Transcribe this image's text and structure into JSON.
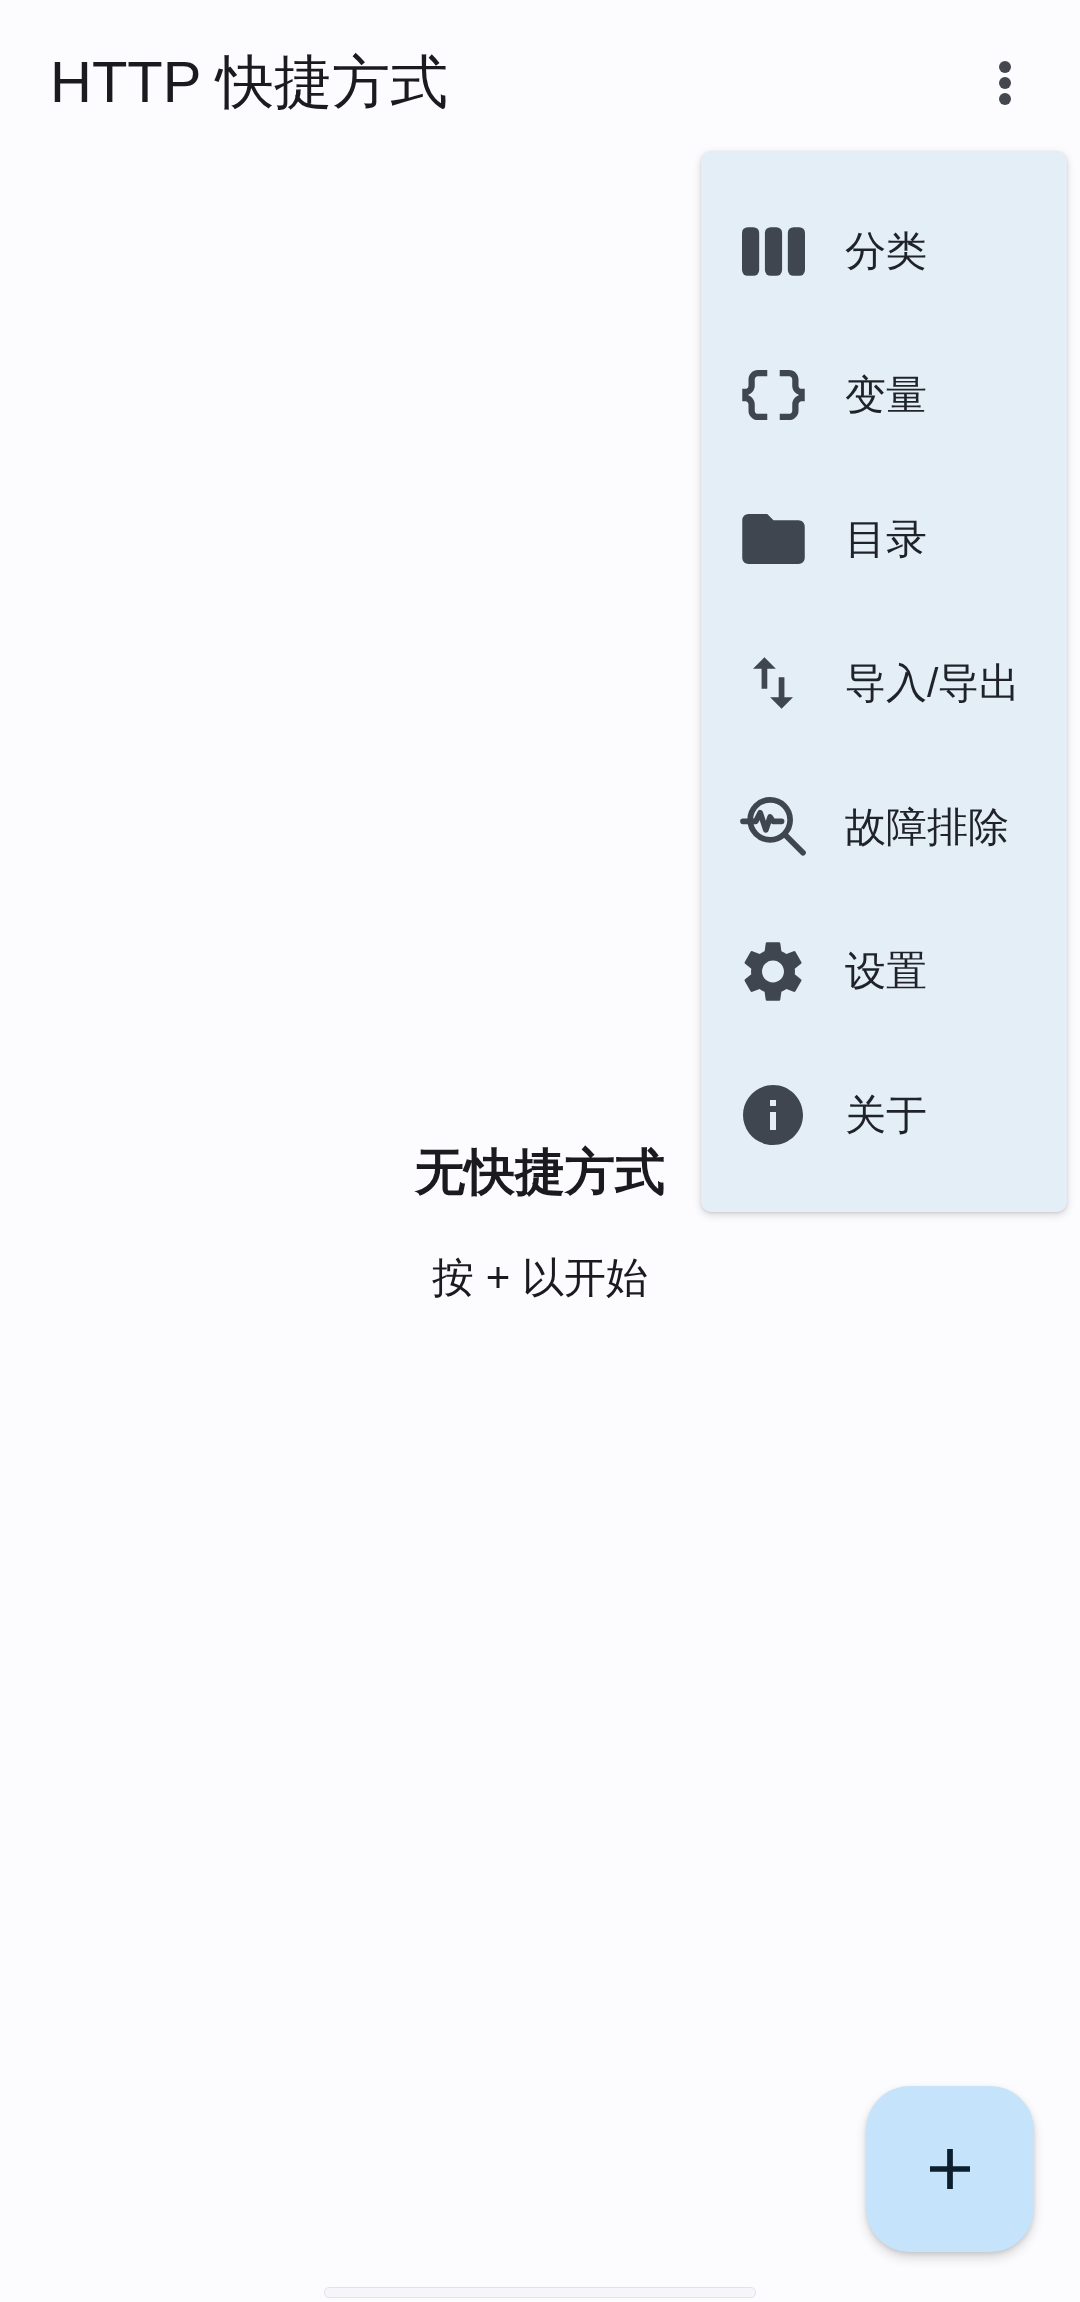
{
  "app_bar": {
    "title": "HTTP 快捷方式"
  },
  "overflow_menu": {
    "items": [
      {
        "label": "分类"
      },
      {
        "label": "变量"
      },
      {
        "label": "目录"
      },
      {
        "label": "导入/导出"
      },
      {
        "label": "故障排除"
      },
      {
        "label": "设置"
      },
      {
        "label": "关于"
      }
    ]
  },
  "empty_state": {
    "title": "无快捷方式",
    "hint": "按 + 以开始"
  }
}
